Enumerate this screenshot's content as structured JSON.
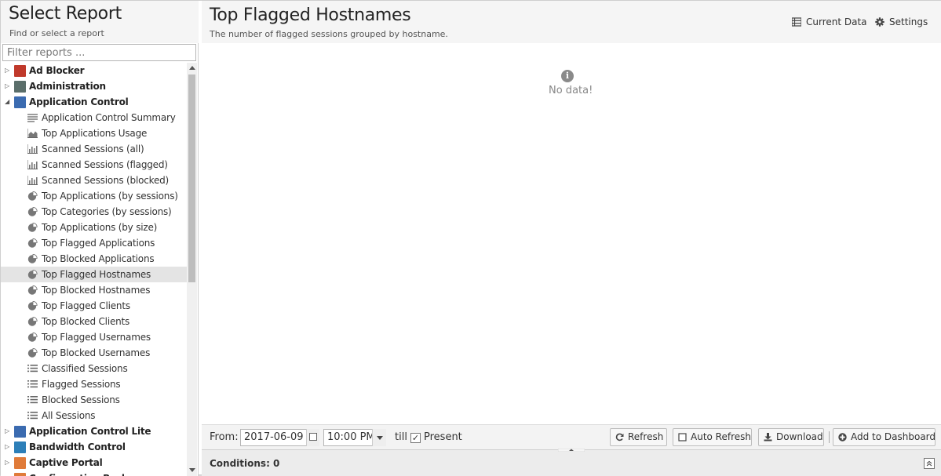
{
  "left": {
    "title": "Select Report",
    "subtitle": "Find or select a report",
    "filter_placeholder": "Filter reports ..."
  },
  "tree": [
    {
      "label": "Ad Blocker",
      "type": "category",
      "expanded": false,
      "icon": "ad-blocker-icon",
      "color": "#c0392b"
    },
    {
      "label": "Administration",
      "type": "category",
      "expanded": false,
      "icon": "administration-icon",
      "color": "#5a6e6a"
    },
    {
      "label": "Application Control",
      "type": "category",
      "expanded": true,
      "icon": "application-control-icon",
      "color": "#3b6bb0"
    },
    {
      "label": "Application Control Summary",
      "type": "report",
      "icon": "text-report-icon"
    },
    {
      "label": "Top Applications Usage",
      "type": "report",
      "icon": "area-chart-icon"
    },
    {
      "label": "Scanned Sessions (all)",
      "type": "report",
      "icon": "bar-chart-icon"
    },
    {
      "label": "Scanned Sessions (flagged)",
      "type": "report",
      "icon": "bar-chart-icon"
    },
    {
      "label": "Scanned Sessions (blocked)",
      "type": "report",
      "icon": "bar-chart-icon"
    },
    {
      "label": "Top Applications (by sessions)",
      "type": "report",
      "icon": "pie-chart-icon"
    },
    {
      "label": "Top Categories (by sessions)",
      "type": "report",
      "icon": "pie-chart-icon"
    },
    {
      "label": "Top Applications (by size)",
      "type": "report",
      "icon": "pie-chart-icon"
    },
    {
      "label": "Top Flagged Applications",
      "type": "report",
      "icon": "pie-chart-icon"
    },
    {
      "label": "Top Blocked Applications",
      "type": "report",
      "icon": "pie-chart-icon"
    },
    {
      "label": "Top Flagged Hostnames",
      "type": "report",
      "icon": "pie-chart-icon",
      "selected": true
    },
    {
      "label": "Top Blocked Hostnames",
      "type": "report",
      "icon": "pie-chart-icon"
    },
    {
      "label": "Top Flagged Clients",
      "type": "report",
      "icon": "pie-chart-icon"
    },
    {
      "label": "Top Blocked Clients",
      "type": "report",
      "icon": "pie-chart-icon"
    },
    {
      "label": "Top Flagged Usernames",
      "type": "report",
      "icon": "pie-chart-icon"
    },
    {
      "label": "Top Blocked Usernames",
      "type": "report",
      "icon": "pie-chart-icon"
    },
    {
      "label": "Classified Sessions",
      "type": "report",
      "icon": "list-icon"
    },
    {
      "label": "Flagged Sessions",
      "type": "report",
      "icon": "list-icon"
    },
    {
      "label": "Blocked Sessions",
      "type": "report",
      "icon": "list-icon"
    },
    {
      "label": "All Sessions",
      "type": "report",
      "icon": "list-icon"
    },
    {
      "label": "Application Control Lite",
      "type": "category",
      "expanded": false,
      "icon": "application-control-lite-icon",
      "color": "#3b6bb0"
    },
    {
      "label": "Bandwidth Control",
      "type": "category",
      "expanded": false,
      "icon": "bandwidth-control-icon",
      "color": "#2d7fb8"
    },
    {
      "label": "Captive Portal",
      "type": "category",
      "expanded": false,
      "icon": "captive-portal-icon",
      "color": "#e07b39"
    },
    {
      "label": "Configuration Backup",
      "type": "category",
      "expanded": false,
      "icon": "configuration-backup-icon",
      "color": "#e07b39"
    }
  ],
  "report": {
    "title": "Top Flagged Hostnames",
    "description": "The number of flagged sessions grouped by hostname.",
    "current_data_label": "Current Data",
    "settings_label": "Settings",
    "no_data": "No data!"
  },
  "toolbar": {
    "from_label": "From:",
    "date_value": "2017-06-09",
    "time_value": "10:00 PM",
    "till_label": "till",
    "present_label": "Present",
    "present_checked": true,
    "refresh_label": "Refresh",
    "auto_refresh_label": "Auto Refresh",
    "download_label": "Download",
    "add_dashboard_label": "Add to Dashboard"
  },
  "conditions": {
    "label": "Conditions: 0"
  }
}
